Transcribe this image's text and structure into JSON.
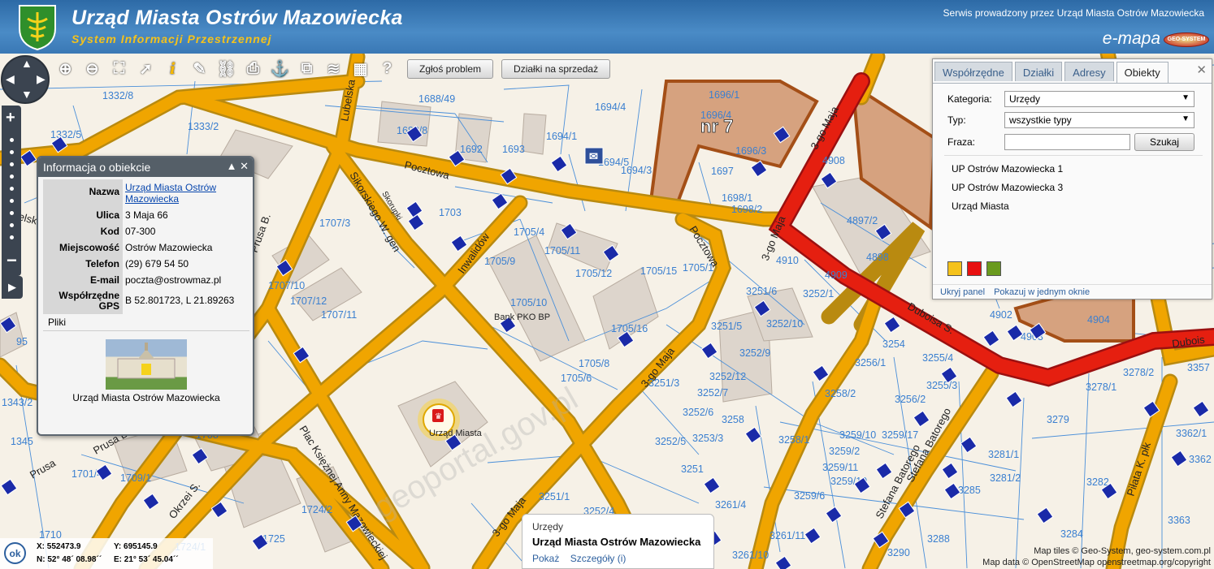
{
  "header": {
    "title": "Urząd Miasta Ostrów Mazowiecka",
    "subtitle": "System Informacji Przestrzennej",
    "service_note": "Serwis prowadzony przez Urząd Miasta Ostrów Mazowiecka",
    "brand": "e-mapa",
    "geo_logo": "GEO-SYSTEM"
  },
  "toolbar": {
    "icons": [
      "zoom-in-icon",
      "zoom-out-icon",
      "full-extent-icon",
      "select-cursor-icon",
      "info-icon",
      "measure-ruler-icon",
      "link-chain-icon",
      "print-icon",
      "anchor-pin-icon",
      "layers-copy-icon",
      "layers-stack-icon",
      "layout-window-icon",
      "help-icon"
    ],
    "report_problem": "Zgłoś problem",
    "plots_for_sale": "Działki na sprzedaż"
  },
  "infobox": {
    "title": "Informacja o obiekcie",
    "fields": [
      {
        "label": "Nazwa",
        "value": "Urząd Miasta Ostrów Mazowiecka"
      },
      {
        "label": "Ulica",
        "value": "3 Maja 66"
      },
      {
        "label": "Kod",
        "value": "07-300"
      },
      {
        "label": "Miejscowość",
        "value": "Ostrów Mazowiecka"
      },
      {
        "label": "Telefon",
        "value": "(29) 679 54 50"
      },
      {
        "label": "E-mail",
        "value": "poczta@ostrowmaz.pl"
      },
      {
        "label": "Współrzędne GPS",
        "value": "B 52.801723, L 21.89263"
      }
    ],
    "files_label": "Pliki",
    "photo_caption": "Urząd Miasta Ostrów Mazowiecka"
  },
  "sidepanel": {
    "tabs": [
      "Współrzędne",
      "Działki",
      "Adresy",
      "Obiekty"
    ],
    "active_tab": "Obiekty",
    "category_label": "Kategoria:",
    "category_value": "Urzędy",
    "type_label": "Typ:",
    "type_value": "wszystkie typy",
    "phrase_label": "Fraza:",
    "phrase_value": "",
    "search_button": "Szukaj",
    "results": [
      "UP Ostrów Mazowiecka 1",
      "UP Ostrów Mazowiecka 3",
      "Urząd Miasta"
    ],
    "swatch_colors": [
      "#f5c21b",
      "#e81010",
      "#6a9a1e"
    ],
    "hide_panel": "Ukryj panel",
    "show_one_window": "Pokazuj w jednym oknie"
  },
  "bottom_popup": {
    "category": "Urzędy",
    "name": "Urząd Miasta Ostrów Mazowiecka",
    "show_link": "Pokaż",
    "details_link": "Szczegóły (i)"
  },
  "coordinates": {
    "ok": "ok",
    "x": "X: 552473.9",
    "y": "Y: 695145.9",
    "n": "N: 52° 48´ 08.98´´",
    "e": "E: 21° 53´ 45.04´´"
  },
  "attribution": {
    "tiles": "Map tiles © Geo-System, geo-system.com.pl",
    "data": "Map data © OpenStreetMap openstreetmap.org/copyright"
  },
  "map": {
    "streets": [
      "Lubelska",
      "Pocztowa",
      "Sikorskiego W. gen",
      "Prusa B.",
      "Inwalidów",
      "Pocztowa",
      "3-go Maja",
      "3-go Maja",
      "3-go Maja",
      "3-go Maja",
      "Duboisa S.",
      "Dubois",
      "Plac Księżnej Anny Mazowieckiej",
      "Okrzei S.",
      "Prusa B.",
      "Stefana Batorego",
      "Stefana Batorego",
      "Piłata K. płk",
      "Skorupki",
      "Lubelska",
      "Prusa"
    ],
    "highlight_label": "nr 7",
    "poi_labels": [
      "Bank PKO BP",
      "Urząd Miasta"
    ],
    "parcels": [
      "1332/8",
      "1332/5",
      "1333/2",
      "1688/49",
      "1688/8",
      "1692",
      "1693",
      "1694/4",
      "1694/1",
      "1694/5",
      "1694/3",
      "1696/1",
      "1696/4",
      "1696/3",
      "1697",
      "1698/1",
      "1698/2",
      "1703",
      "1707/3",
      "1705/4",
      "1705/11",
      "1705/12",
      "1705/15",
      "1705/1",
      "1705/9",
      "1705/10",
      "1705/16",
      "1705/8",
      "1705/6",
      "1707/10",
      "1707/12",
      "1707/11",
      "4897/2",
      "4898",
      "4910",
      "4909",
      "4902",
      "4903",
      "4904",
      "4908",
      "3251/6",
      "3252/1",
      "3252/10",
      "3251/5",
      "3252/9",
      "3252/12",
      "3251/3",
      "3252/7",
      "3252/6",
      "3258",
      "3252/5",
      "3253/3",
      "3258/2",
      "3256/1",
      "3254",
      "3255/4",
      "3255/3",
      "3256/2",
      "3259/10",
      "3259/17",
      "3259/2",
      "3258/1",
      "3259/11",
      "3259/19",
      "3259/6",
      "3261/4",
      "3261/11",
      "3261/10",
      "3261/1",
      "3252/4",
      "3251/1",
      "3279",
      "3281/1",
      "3281/2",
      "3285",
      "3282",
      "3284",
      "3288",
      "3290",
      "3278/1",
      "3278/2",
      "3357",
      "3362/1",
      "3362",
      "3363",
      "1709/1",
      "1701/4",
      "1345",
      "1343/2",
      "1710",
      "1724/2",
      "1724/1",
      "1704",
      "1706",
      "1725",
      "1708",
      "95",
      "3251"
    ]
  }
}
